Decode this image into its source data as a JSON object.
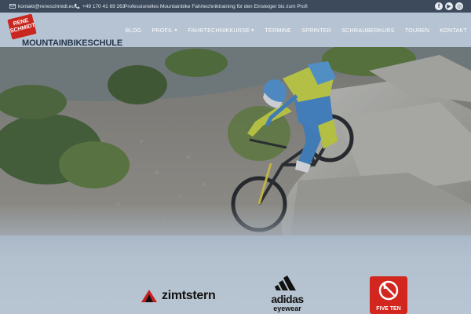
{
  "topbar": {
    "email": "kontakt@reneschmidt.eu",
    "phone": "+49 170 41 69 263",
    "tagline": "Professionelles Mountainbike Fahrtechniktraining für den Einsteiger bis zum Profi",
    "social": [
      {
        "icon": "facebook-icon",
        "glyph": "f"
      },
      {
        "icon": "youtube-icon",
        "glyph": "▶"
      },
      {
        "icon": "instagram-icon",
        "glyph": "◎"
      }
    ]
  },
  "logo": {
    "line1": "RENE",
    "line2": "SCHMIDT",
    "wordmark": "MOUNTAINBIKESCHULE",
    "badge_color": "#c9261f"
  },
  "nav": {
    "items": [
      {
        "label": "BLOG",
        "dropdown": false
      },
      {
        "label": "PROFIL",
        "dropdown": true
      },
      {
        "label": "FAHRTECHNIKKURSE",
        "dropdown": true
      },
      {
        "label": "TERMINE",
        "dropdown": false
      },
      {
        "label": "SPRINTER",
        "dropdown": false
      },
      {
        "label": "SCHRAUBERKURS",
        "dropdown": false
      },
      {
        "label": "TOUREN",
        "dropdown": false
      },
      {
        "label": "KONTAKT",
        "dropdown": false
      }
    ]
  },
  "hero": {
    "image": "mountain-biker-descending-rocks"
  },
  "sponsors": {
    "zimtstern": "zimtstern",
    "adidas": "adidas",
    "adidas_sub": "eyewear",
    "fiveten": "FIVE TEN"
  },
  "colors": {
    "topbar": "#3c4a5c",
    "header": "#b6c3d2",
    "accent_red": "#d2261f"
  }
}
